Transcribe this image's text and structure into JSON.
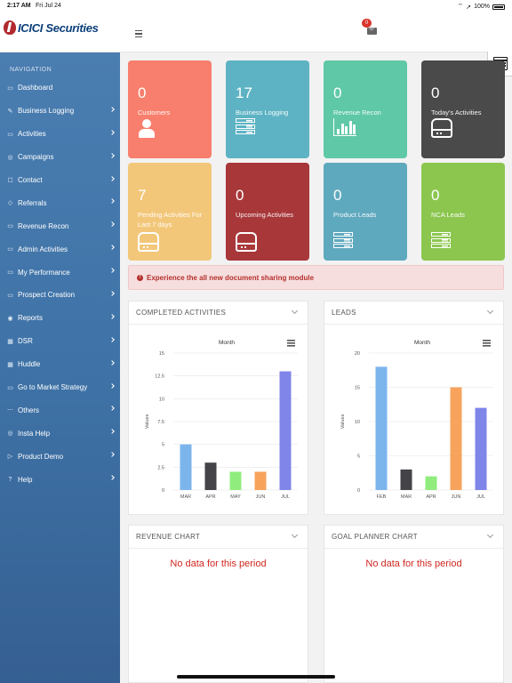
{
  "status_bar": {
    "time": "2:17 AM",
    "date": "Fri Jul 24",
    "battery": "100%"
  },
  "header": {
    "logo_text": "ICICI Securities",
    "mail_count": "0"
  },
  "sidebar": {
    "title": "NAVIGATION",
    "items": [
      {
        "label": "Dashboard",
        "icon": "monitor-icon",
        "has_children": false
      },
      {
        "label": "Business Logging",
        "icon": "brush-icon",
        "has_children": true
      },
      {
        "label": "Activities",
        "icon": "folder-icon",
        "has_children": true
      },
      {
        "label": "Campaigns",
        "icon": "target-icon",
        "has_children": true
      },
      {
        "label": "Contact",
        "icon": "contact-icon",
        "has_children": true
      },
      {
        "label": "Referrals",
        "icon": "tag-icon",
        "has_children": true
      },
      {
        "label": "Revenue Recon",
        "icon": "folder-icon",
        "has_children": true
      },
      {
        "label": "Admin Activities",
        "icon": "folder-icon",
        "has_children": true
      },
      {
        "label": "My Performance",
        "icon": "folder-icon",
        "has_children": true
      },
      {
        "label": "Prospect Creation",
        "icon": "folder-icon",
        "has_children": true
      },
      {
        "label": "Reports",
        "icon": "palette-icon",
        "has_children": true
      },
      {
        "label": "DSR",
        "icon": "grid-icon",
        "has_children": true
      },
      {
        "label": "Huddle",
        "icon": "grid-icon",
        "has_children": true
      },
      {
        "label": "Go to Market Strategy",
        "icon": "folder-icon",
        "has_children": true
      },
      {
        "label": "Others",
        "icon": "ellipsis-icon",
        "has_children": true
      },
      {
        "label": "Insta Help",
        "icon": "target-icon",
        "has_children": true
      },
      {
        "label": "Product Demo",
        "icon": "play-icon",
        "has_children": true
      },
      {
        "label": "Help",
        "icon": "help-icon",
        "has_children": true
      }
    ]
  },
  "tiles": [
    {
      "value": "0",
      "label": "Customers",
      "color": "#f87f6d",
      "icon": "user-icon"
    },
    {
      "value": "17",
      "label": "Business Logging",
      "color": "#5db3c4",
      "icon": "server-icon"
    },
    {
      "value": "0",
      "label": "Revenue Recon",
      "color": "#5fc8a6",
      "icon": "bar-chart-icon"
    },
    {
      "value": "0",
      "label": "Today's Activities",
      "color": "#4a4a4a",
      "icon": "hard-drive-icon"
    },
    {
      "value": "7",
      "label": "Pending Activities For Last 7 days",
      "color": "#f3c77a",
      "icon": "hard-drive-icon"
    },
    {
      "value": "0",
      "label": "Upcoming Activities",
      "color": "#a8373a",
      "icon": "hard-drive-icon"
    },
    {
      "value": "0",
      "label": "Product Leads",
      "color": "#5fa9be",
      "icon": "server-icon"
    },
    {
      "value": "0",
      "label": "NCA Leads",
      "color": "#8cc64f",
      "icon": "server-icon"
    }
  ],
  "alert": {
    "text": "Experience the all new document sharing module",
    "icon_text": "!"
  },
  "panels": {
    "completed": {
      "title": "COMPLETED ACTIVITIES"
    },
    "leads": {
      "title": "LEADS"
    },
    "revenue": {
      "title": "REVENUE CHART",
      "empty_text": "No data for this period"
    },
    "goal": {
      "title": "GOAL PLANNER CHART",
      "empty_text": "No data for this period"
    }
  },
  "chart_data": [
    {
      "type": "bar",
      "title": "Month",
      "ylabel": "Values",
      "xlabel": "",
      "categories": [
        "MAR",
        "APR",
        "MAY",
        "JUN",
        "JUL"
      ],
      "values": [
        5,
        3,
        2,
        2,
        13
      ],
      "colors": [
        "#7cb5ec",
        "#434348",
        "#90ed7d",
        "#f7a35c",
        "#8085e9"
      ],
      "ylim": [
        0,
        15
      ],
      "yticks": [
        "0",
        "2.5",
        "5",
        "7.5",
        "10",
        "12.5",
        "15"
      ],
      "ytick_values": [
        0,
        2.5,
        5,
        7.5,
        10,
        12.5,
        15
      ],
      "grid": true
    },
    {
      "type": "bar",
      "title": "Month",
      "ylabel": "Values",
      "xlabel": "",
      "categories": [
        "FEB",
        "MAR",
        "APR",
        "JUN",
        "JUL"
      ],
      "values": [
        18,
        3,
        2,
        15,
        12
      ],
      "colors": [
        "#7cb5ec",
        "#434348",
        "#90ed7d",
        "#f7a35c",
        "#8085e9"
      ],
      "ylim": [
        0,
        20
      ],
      "yticks": [
        "0",
        "5",
        "10",
        "15",
        "20"
      ],
      "ytick_values": [
        0,
        5,
        10,
        15,
        20
      ],
      "grid": true
    }
  ]
}
